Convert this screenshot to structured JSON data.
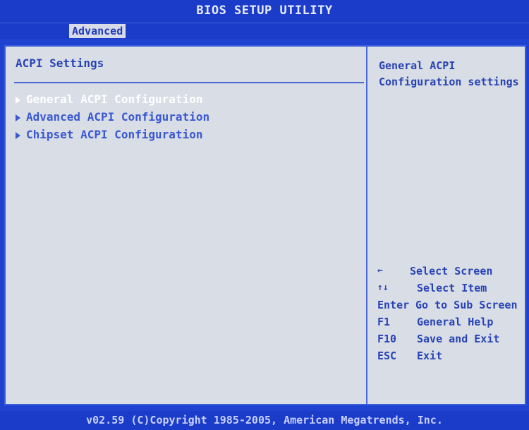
{
  "title": "BIOS SETUP UTILITY",
  "tabs": [
    {
      "label": "Advanced",
      "active": true
    }
  ],
  "main": {
    "section_title": "ACPI Settings",
    "menu_items": [
      {
        "label": "General ACPI Configuration",
        "selected": true
      },
      {
        "label": "Advanced ACPI Configuration",
        "selected": false
      },
      {
        "label": "Chipset ACPI Configuration",
        "selected": false
      }
    ]
  },
  "help": {
    "line1": "General ACPI",
    "line2": "Configuration settings"
  },
  "keys": [
    {
      "key": "←",
      "desc": "Select Screen"
    },
    {
      "key": "↑↓",
      "desc": "Select Item"
    },
    {
      "key": "Enter",
      "desc": "Go to Sub Screen"
    },
    {
      "key": "F1",
      "desc": "General Help"
    },
    {
      "key": "F10",
      "desc": "Save and Exit"
    },
    {
      "key": "ESC",
      "desc": "Exit"
    }
  ],
  "footer": "v02.59 (C)Copyright 1985-2005, American Megatrends, Inc.",
  "colors": {
    "background": "#1f42d0",
    "panel": "#d9dde6",
    "text_blue": "#2844b4",
    "selected_text": "#ffffff"
  }
}
